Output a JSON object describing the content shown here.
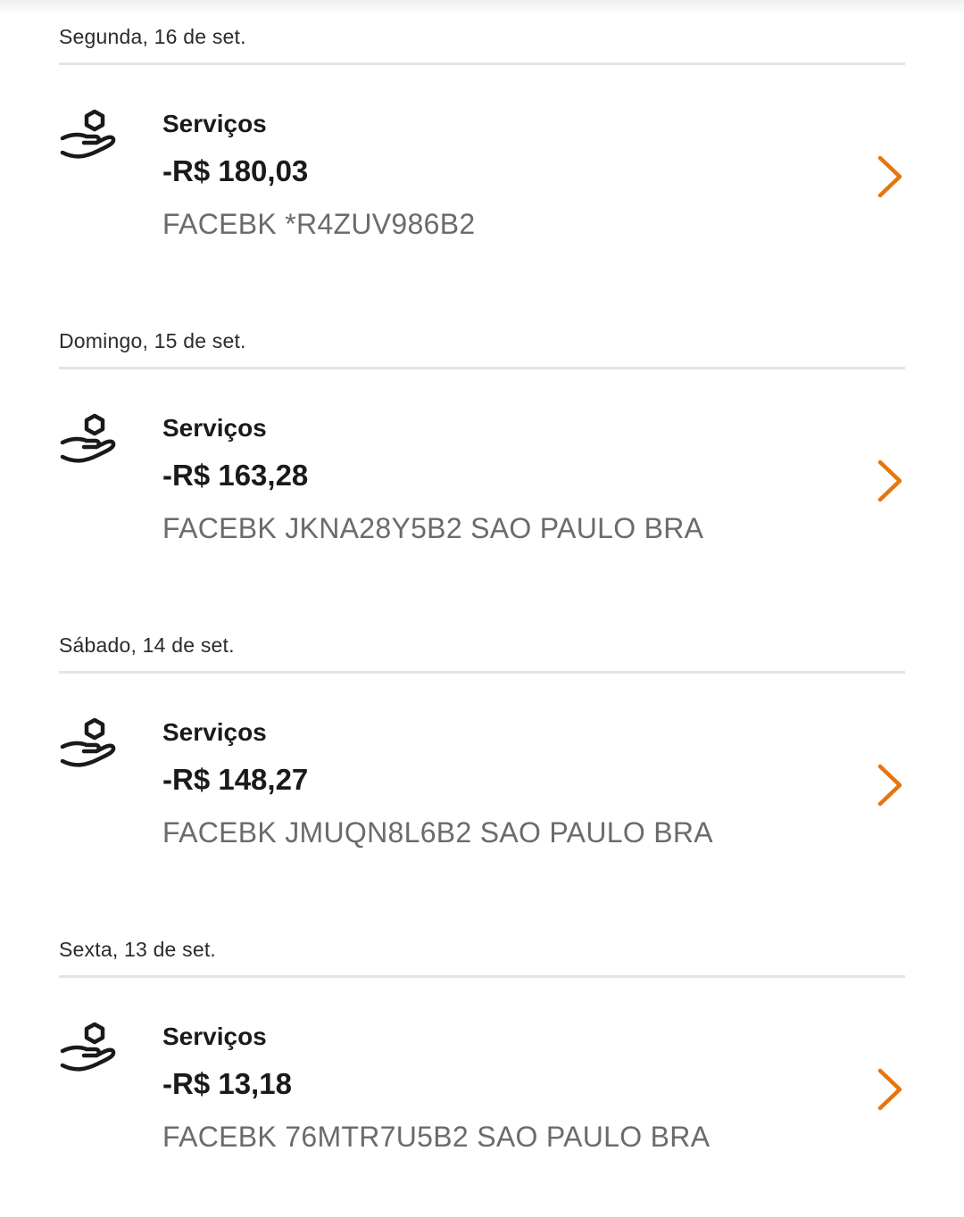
{
  "accent_color": "#e5760f",
  "transactions": [
    {
      "date": "Segunda, 16 de set.",
      "category": "Serviços",
      "amount": "-R$ 180,03",
      "merchant": "FACEBK *R4ZUV986B2",
      "icon": "hand-coin-icon"
    },
    {
      "date": "Domingo, 15 de set.",
      "category": "Serviços",
      "amount": "-R$ 163,28",
      "merchant": "FACEBK JKNA28Y5B2 SAO PAULO BRA",
      "icon": "hand-coin-icon"
    },
    {
      "date": "Sábado, 14 de set.",
      "category": "Serviços",
      "amount": "-R$ 148,27",
      "merchant": "FACEBK JMUQN8L6B2 SAO PAULO BRA",
      "icon": "hand-coin-icon"
    },
    {
      "date": "Sexta, 13 de set.",
      "category": "Serviços",
      "amount": "-R$ 13,18",
      "merchant": "FACEBK 76MTR7U5B2 SAO PAULO BRA",
      "icon": "hand-coin-icon"
    }
  ]
}
